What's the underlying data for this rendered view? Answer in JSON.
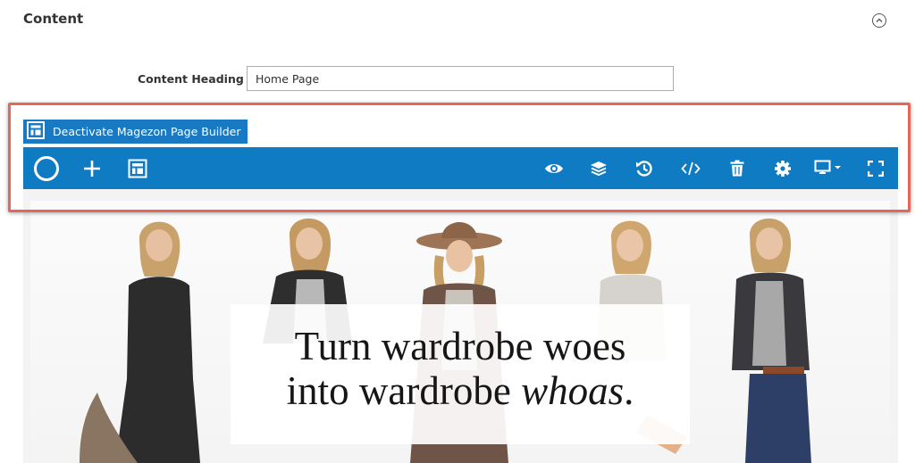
{
  "section": {
    "title": "Content"
  },
  "content_heading": {
    "label": "Content Heading",
    "value": "Home Page"
  },
  "page_builder": {
    "deactivate_label": "Deactivate Magezon Page Builder",
    "toolbar_left_icons": [
      "magezon-logo-icon",
      "plus-icon",
      "layout-icon"
    ],
    "toolbar_right_icons": [
      "eye-icon",
      "layers-icon",
      "history-icon",
      "code-icon",
      "trash-icon",
      "gear-icon",
      "desktop-dropdown-icon",
      "fullscreen-icon"
    ]
  },
  "banner": {
    "line1": "Turn wardrobe woes",
    "line2_prefix": "into wardrobe ",
    "line2_emphasis": "whoas",
    "line2_suffix": "."
  },
  "colors": {
    "toolbar": "#0f7bc2",
    "button": "#1979c3",
    "highlight_frame": "#e5675b"
  }
}
